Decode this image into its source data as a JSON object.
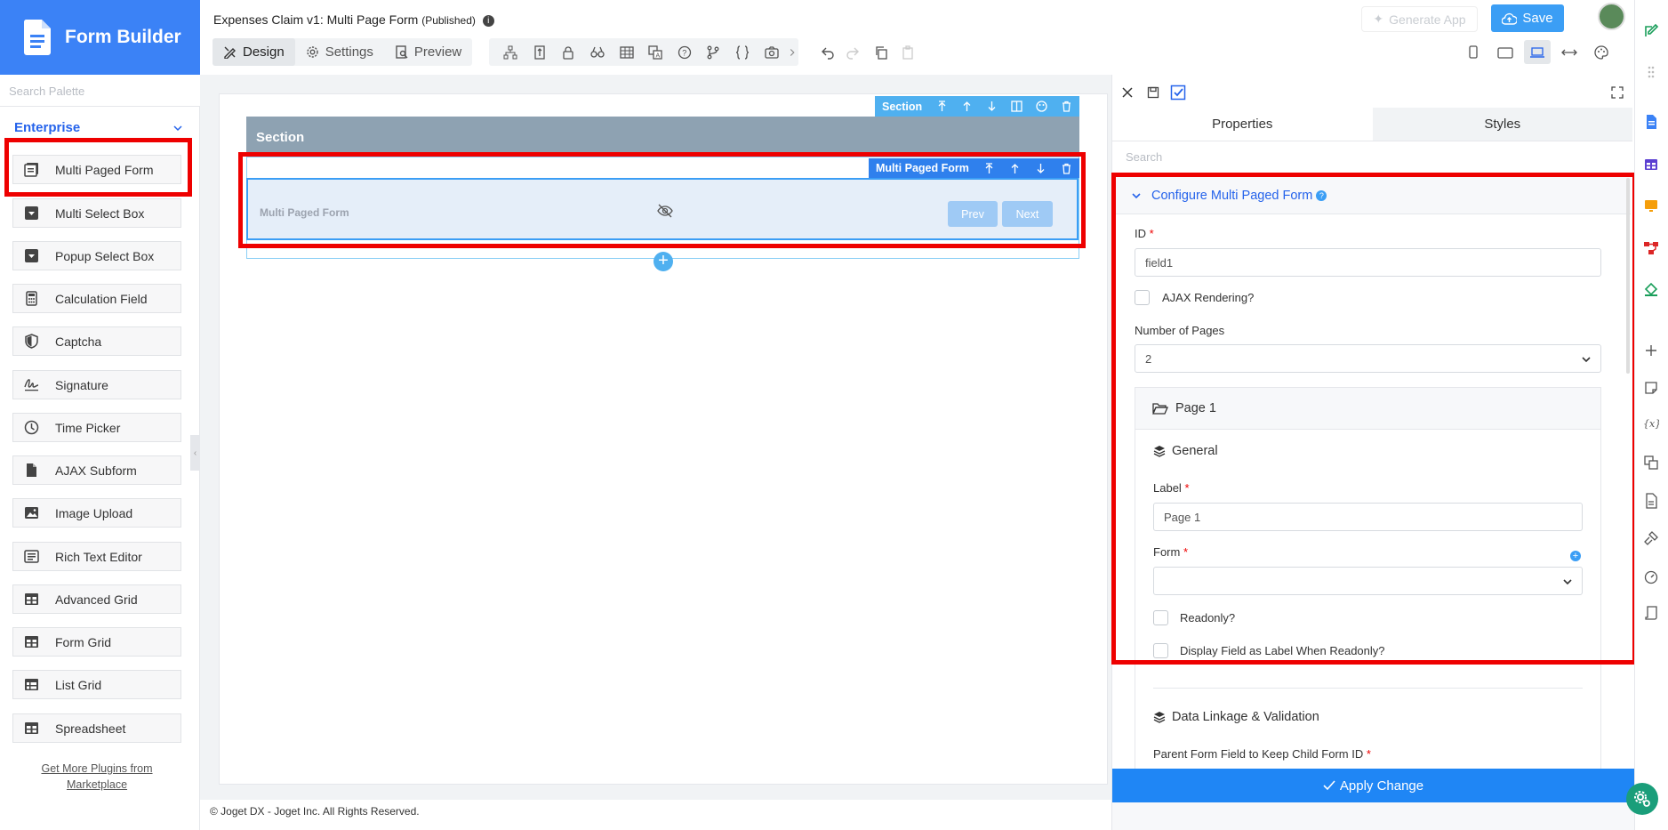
{
  "app": {
    "brand": "Form Builder"
  },
  "palette": {
    "search_placeholder": "Search Palette",
    "category": "Enterprise",
    "items": [
      {
        "label": "Multi Paged Form",
        "icon": "multi-paged-form-icon"
      },
      {
        "label": "Multi Select Box",
        "icon": "select-box-icon"
      },
      {
        "label": "Popup Select Box",
        "icon": "select-box-icon"
      },
      {
        "label": "Calculation Field",
        "icon": "calculator-icon"
      },
      {
        "label": "Captcha",
        "icon": "shield-icon"
      },
      {
        "label": "Signature",
        "icon": "signature-icon"
      },
      {
        "label": "Time Picker",
        "icon": "clock-icon"
      },
      {
        "label": "AJAX Subform",
        "icon": "file-icon"
      },
      {
        "label": "Image Upload",
        "icon": "image-icon"
      },
      {
        "label": "Rich Text Editor",
        "icon": "text-editor-icon"
      },
      {
        "label": "Advanced Grid",
        "icon": "grid-icon"
      },
      {
        "label": "Form Grid",
        "icon": "grid-icon"
      },
      {
        "label": "List Grid",
        "icon": "list-grid-icon"
      },
      {
        "label": "Spreadsheet",
        "icon": "grid-icon"
      }
    ],
    "get_more_line1": "Get More Plugins from",
    "get_more_line2": "Marketplace"
  },
  "header": {
    "title": "Expenses Claim v1: Multi Page Form",
    "status": "(Published)",
    "tabs": [
      {
        "label": "Design",
        "icon": "design-icon",
        "active": true
      },
      {
        "label": "Settings",
        "icon": "gear-icon",
        "active": false
      },
      {
        "label": "Preview",
        "icon": "preview-icon",
        "active": false
      }
    ],
    "generate_app": "Generate App",
    "save": "Save",
    "colors": {
      "accent": "#3b9ef5",
      "brand": "#3b82f6",
      "highlight": "#ee0000"
    }
  },
  "canvas": {
    "section_toolbar_label": "Section",
    "section_title": "Section",
    "element_toolbar_label": "Multi Paged Form",
    "element_label": "Multi Paged Form",
    "prev": "Prev",
    "next": "Next",
    "add": "+"
  },
  "footer": {
    "text": "© Joget DX - Joget Inc. All Rights Reserved."
  },
  "properties": {
    "tabs": [
      "Properties",
      "Styles"
    ],
    "search_placeholder": "Search",
    "section_title": "Configure Multi Paged Form",
    "id_label": "ID",
    "id_value": "field1",
    "ajax_label": "AJAX Rendering?",
    "pages_label": "Number of Pages",
    "pages_value": "2",
    "page1": {
      "title": "Page 1",
      "general": "General",
      "label_label": "Label",
      "label_value": "Page 1",
      "form_label": "Form",
      "form_value": "",
      "readonly_label": "Readonly?",
      "display_label": "Display Field as Label When Readonly?"
    },
    "linkage_title": "Data Linkage & Validation",
    "parent_field_label": "Parent Form Field to Keep Child Form ID",
    "apply": "Apply Change"
  }
}
